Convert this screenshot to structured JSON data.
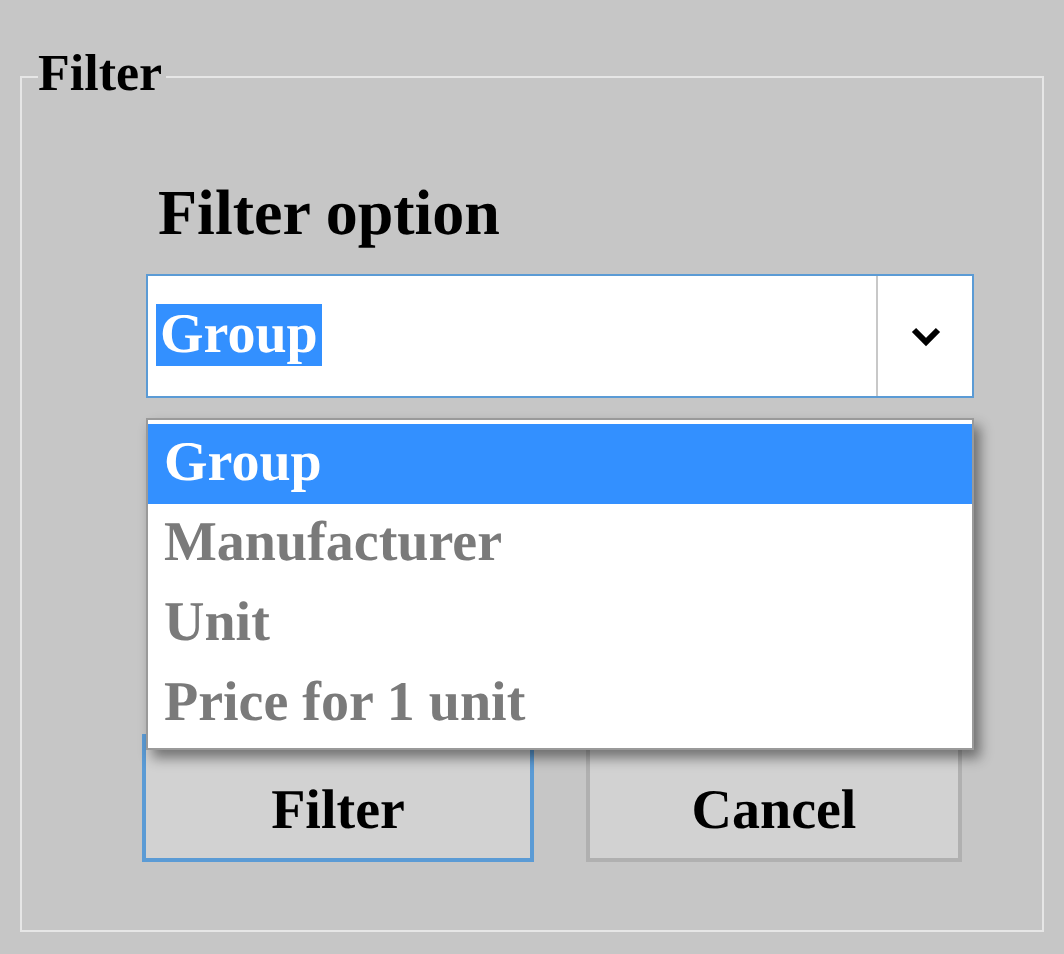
{
  "fieldset": {
    "legend": "Filter"
  },
  "filter_option": {
    "label": "Filter option",
    "value": "Group",
    "text_selected": true,
    "expanded": true,
    "options": [
      {
        "label": "Group",
        "selected": true
      },
      {
        "label": "Manufacturer",
        "selected": false
      },
      {
        "label": "Unit",
        "selected": false
      },
      {
        "label": "Price for 1 unit",
        "selected": false
      }
    ]
  },
  "buttons": [
    {
      "label": "Filter",
      "default": true
    },
    {
      "label": "Cancel",
      "default": false
    }
  ]
}
